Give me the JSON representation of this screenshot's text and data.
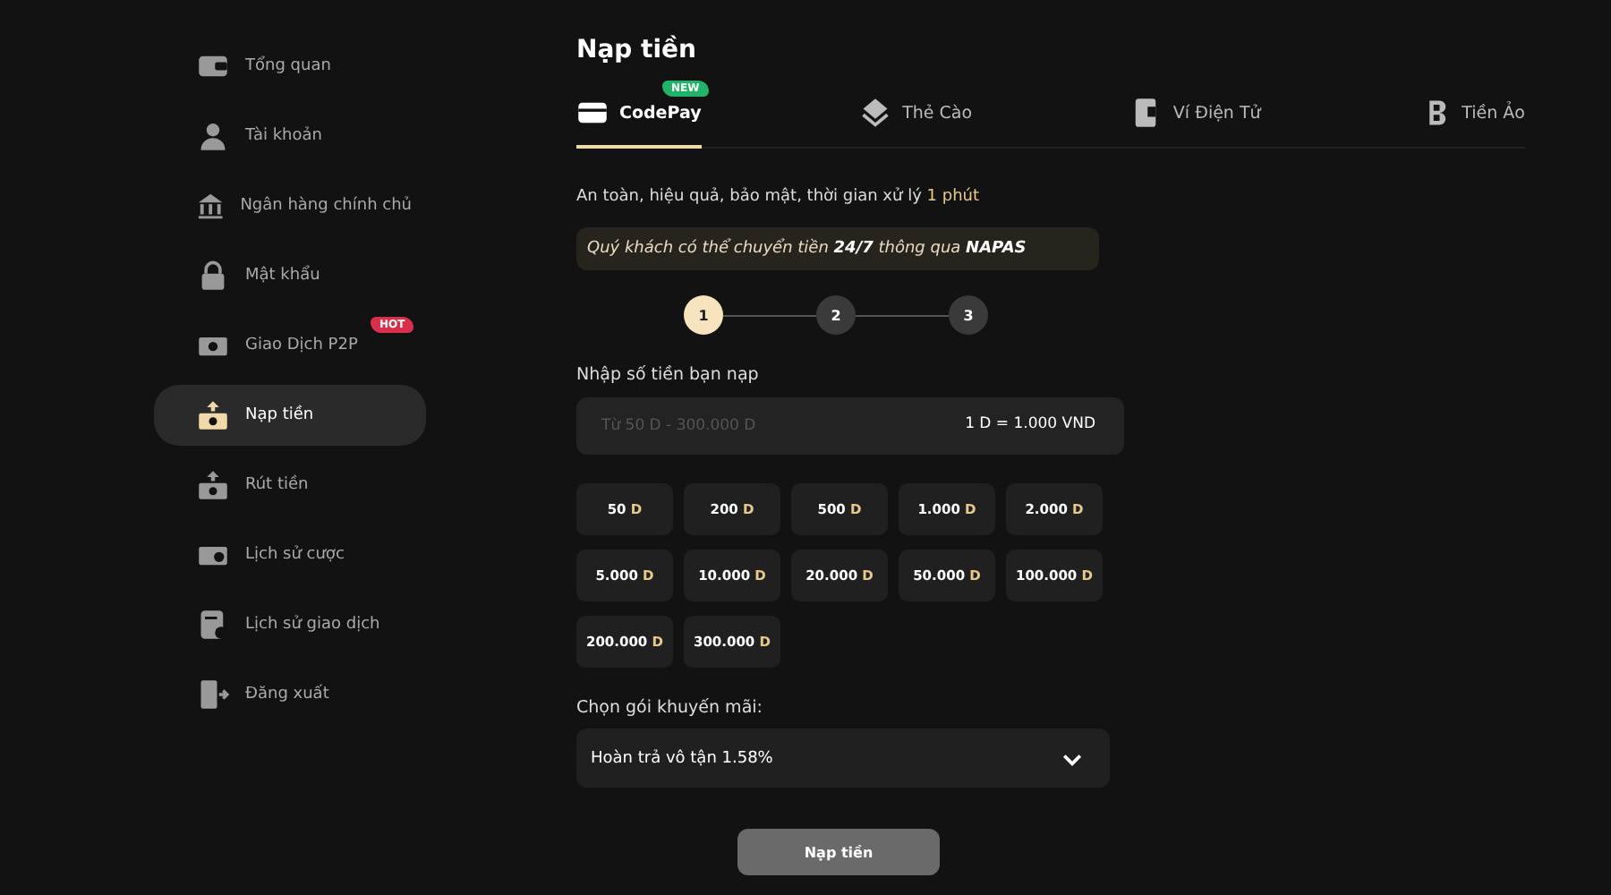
{
  "sidebar": {
    "items": [
      {
        "label": "Tổng quan",
        "selected": false
      },
      {
        "label": "Tài khoản",
        "selected": false
      },
      {
        "label": "Ngân hàng chính chủ",
        "selected": false
      },
      {
        "label": "Mật khẩu",
        "selected": false
      },
      {
        "label": "Giao Dịch P2P",
        "selected": false,
        "badge": "HOT"
      },
      {
        "label": "Nạp tiền",
        "selected": true
      },
      {
        "label": "Rút tiền",
        "selected": false
      },
      {
        "label": "Lịch sử cược",
        "selected": false
      },
      {
        "label": "Lịch sử giao dịch",
        "selected": false
      },
      {
        "label": "Đăng xuất",
        "selected": false
      }
    ]
  },
  "page_title": "Nạp tiền",
  "tabs": [
    {
      "label": "CodePay",
      "selected": true,
      "badge": "NEW"
    },
    {
      "label": "Thẻ Cào",
      "selected": false
    },
    {
      "label": "Ví Điện Tử",
      "selected": false
    },
    {
      "label": "Tiền Ảo",
      "selected": false
    }
  ],
  "info": {
    "text": "An toàn, hiệu quả, bảo mật, thời gian xử lý",
    "highlight": "1 phút"
  },
  "notice": "Quý khách có thể chuyển tiền **24/7** thông qua **NAPAS**",
  "steps": [
    {
      "label": "1",
      "selected": true
    },
    {
      "label": "2",
      "selected": false
    },
    {
      "label": "3",
      "selected": false
    }
  ],
  "amount_field": {
    "label": "Nhập số tiền bạn nạp",
    "placeholder": "Từ 50 D - 300.000 D",
    "rate": "1 D = 1.000 VND"
  },
  "amounts": [
    {
      "amount": "50",
      "unit": "D"
    },
    {
      "amount": "200",
      "unit": "D"
    },
    {
      "amount": "500",
      "unit": "D"
    },
    {
      "amount": "1.000",
      "unit": "D"
    },
    {
      "amount": "2.000",
      "unit": "D"
    },
    {
      "amount": "5.000",
      "unit": "D"
    },
    {
      "amount": "10.000",
      "unit": "D"
    },
    {
      "amount": "20.000",
      "unit": "D"
    },
    {
      "amount": "50.000",
      "unit": "D"
    },
    {
      "amount": "100.000",
      "unit": "D"
    },
    {
      "amount": "200.000",
      "unit": "D"
    },
    {
      "amount": "300.000",
      "unit": "D"
    }
  ],
  "promo": {
    "label": "Chọn gói khuyến mãi:",
    "value": "Hoàn trả vô tận 1.58%"
  },
  "submit": "Nạp tiền"
}
